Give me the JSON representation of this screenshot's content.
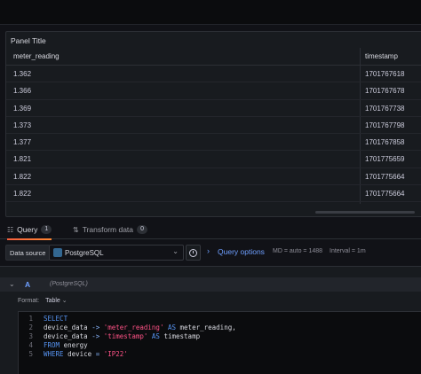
{
  "panel": {
    "title": "Panel Title",
    "columns": [
      "meter_reading",
      "timestamp"
    ],
    "rows": [
      [
        "1.362",
        "1701767618"
      ],
      [
        "1.366",
        "1701767678"
      ],
      [
        "1.369",
        "1701767738"
      ],
      [
        "1.373",
        "1701767798"
      ],
      [
        "1.377",
        "1701767858"
      ],
      [
        "1.821",
        "1701775659"
      ],
      [
        "1.822",
        "1701775664"
      ],
      [
        "1.822",
        "1701775664"
      ]
    ]
  },
  "tabs": [
    {
      "label": "Query",
      "count": "1",
      "icon": "database-icon"
    },
    {
      "label": "Transform data",
      "count": "0",
      "icon": "transform-icon"
    }
  ],
  "query_row": {
    "datasource_label": "Data source",
    "datasource_value": "PostgreSQL",
    "query_options": "Query options",
    "meta_md": "MD = auto = 1488",
    "meta_interval": "Interval = 1m"
  },
  "query": {
    "ref_id": "A",
    "datasource_name": "(PostgreSQL)",
    "format_label": "Format:",
    "format_value": "Table",
    "lines": [
      {
        "n": "1",
        "text": "SELECT"
      },
      {
        "n": "2",
        "text": "device_data -> 'meter_reading' AS meter_reading,"
      },
      {
        "n": "3",
        "text": "device_data -> 'timestamp' AS timestamp"
      },
      {
        "n": "4",
        "text": "FROM energy"
      },
      {
        "n": "5",
        "text": "WHERE device = 'IP22'"
      }
    ]
  },
  "colors": {
    "background": "#111217",
    "panel": "#181b1f",
    "accent_blue": "#6e9fff",
    "keyword": "#5794f2",
    "string": "#ff5286",
    "active_tab": "#ff8833"
  }
}
